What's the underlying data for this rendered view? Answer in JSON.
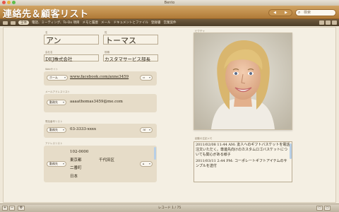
{
  "window": {
    "app_title": "Bento"
  },
  "header": {
    "title": "連絡先＆顧客リスト",
    "nav_back": "◀",
    "nav_forward": "▶",
    "search_placeholder": "検索"
  },
  "tabs": [
    "全体",
    "電話、ミーティング、To-Do 項目",
    "メモと履歴",
    "メール",
    "ドキュメントとファイル",
    "登録書",
    "営業案件"
  ],
  "fields": {
    "first_name_label": "名",
    "first_name": "アン",
    "last_name_label": "姓",
    "last_name": "トーマス",
    "company_label": "会社名",
    "company": "DEJ株式会社",
    "title_label": "役職",
    "title": "カスタマサービス部長",
    "url_label": "Webサイト",
    "url_type": "ホーム",
    "url": "www.facebook.com/anne3459",
    "email_label": "メールアドレスリスト",
    "email_type": "勤務先",
    "email": "aaaathomas3459@me.com",
    "phone_label": "電話番号リスト",
    "phone_type": "勤務先",
    "phone": "03-3333-xxxx",
    "address_label": "アドレスリスト",
    "address_type": "勤務先",
    "address_zip": "102-0000",
    "address_city": "東京都",
    "address_ward": "千代田区",
    "address_line": "二番町",
    "address_country": "日本",
    "photo_label": "ピクチャ",
    "history_label": "起動の注記メモ"
  },
  "history": [
    "2011/02/08 11:44 AM: 友人へのギフトバスケットを電話注文いただく。専進先向けのカスタムロゴバスケットについても関心がある様子",
    "2011/03/11 2:44 PM: コーポレートギフトアイテムのサンプルを送付"
  ],
  "footer": {
    "record_text": "レコード 1 / 75"
  },
  "colors": {
    "header": "#c08b45",
    "tabbar": "#5e4c33",
    "background": "#efe8d9"
  }
}
